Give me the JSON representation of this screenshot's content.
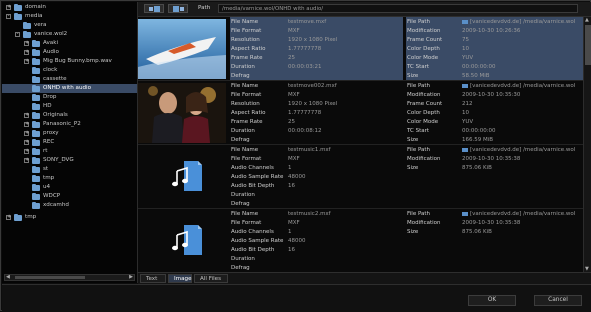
{
  "path_label": "Path",
  "path_value": "/media/varnice.wol/ONHD with audio/",
  "tree": [
    {
      "label": "domain",
      "level": 0,
      "expander": "+"
    },
    {
      "label": "media",
      "level": 0,
      "expander": "-"
    },
    {
      "label": "vera",
      "level": 1,
      "expander": ""
    },
    {
      "label": "vanice.wol2",
      "level": 1,
      "expander": "-"
    },
    {
      "label": "Avaki",
      "level": 2,
      "expander": "+"
    },
    {
      "label": "Audio",
      "level": 2,
      "expander": "+"
    },
    {
      "label": "Mig Bug Bunny.bmp.wav",
      "level": 2,
      "expander": "+"
    },
    {
      "label": "clock",
      "level": 2,
      "expander": ""
    },
    {
      "label": "cassette",
      "level": 2,
      "expander": ""
    },
    {
      "label": "ONHD with audio",
      "level": 2,
      "expander": "",
      "selected": true
    },
    {
      "label": "Drop",
      "level": 2,
      "expander": ""
    },
    {
      "label": "HD",
      "level": 2,
      "expander": ""
    },
    {
      "label": "Originals",
      "level": 2,
      "expander": "+"
    },
    {
      "label": "Panasonic_P2",
      "level": 2,
      "expander": "+"
    },
    {
      "label": "proxy",
      "level": 2,
      "expander": "+"
    },
    {
      "label": "REC",
      "level": 2,
      "expander": "+"
    },
    {
      "label": "rt",
      "level": 2,
      "expander": "+"
    },
    {
      "label": "SONY_DVG",
      "level": 2,
      "expander": "+"
    },
    {
      "label": "st",
      "level": 2,
      "expander": ""
    },
    {
      "label": "tmp",
      "level": 2,
      "expander": ""
    },
    {
      "label": "u4",
      "level": 2,
      "expander": ""
    },
    {
      "label": "WDCP",
      "level": 2,
      "expander": ""
    },
    {
      "label": "xdcamhd",
      "level": 2,
      "expander": ""
    },
    {
      "label": "tmp",
      "level": 0,
      "expander": "+",
      "gap": true
    }
  ],
  "entries": [
    {
      "thumb": "boat",
      "selected": true,
      "left": [
        {
          "k": "File Name",
          "v": "testmove.mxf"
        },
        {
          "k": "File Format",
          "v": "MXF"
        },
        {
          "k": "Resolution",
          "v": "1920 x 1080 Pixel"
        },
        {
          "k": "Aspect Ratio",
          "v": "1.77777778"
        },
        {
          "k": "Frame Rate",
          "v": "25"
        },
        {
          "k": "Duration",
          "v": "00:00:03:21"
        },
        {
          "k": "Defrag",
          "v": ""
        }
      ],
      "right": [
        {
          "k": "File Path",
          "v": "[vanicedevdvd.de] /media/varnice.wol",
          "link": true
        },
        {
          "k": "Modification",
          "v": "2009-10-30 10:26:36"
        },
        {
          "k": "Frame Count",
          "v": "75"
        },
        {
          "k": "Color Depth",
          "v": "10"
        },
        {
          "k": "Color Mode",
          "v": "YUV"
        },
        {
          "k": "TC Start",
          "v": "00:00:00:00"
        },
        {
          "k": "Size",
          "v": "58.50 MiB"
        }
      ]
    },
    {
      "thumb": "couple",
      "selected": false,
      "left": [
        {
          "k": "File Name",
          "v": "testmove002.mxf"
        },
        {
          "k": "File Format",
          "v": "MXF"
        },
        {
          "k": "Resolution",
          "v": "1920 x 1080 Pixel"
        },
        {
          "k": "Aspect Ratio",
          "v": "1.77777778"
        },
        {
          "k": "Frame Rate",
          "v": "25"
        },
        {
          "k": "Duration",
          "v": "00:00:08:12"
        },
        {
          "k": "Defrag",
          "v": ""
        }
      ],
      "right": [
        {
          "k": "File Path",
          "v": "[vanicedevdvd.de] /media/varnice.wol",
          "link": true
        },
        {
          "k": "Modification",
          "v": "2009-10-30 10:35:30"
        },
        {
          "k": "Frame Count",
          "v": "212"
        },
        {
          "k": "Color Depth",
          "v": "10"
        },
        {
          "k": "Color Mode",
          "v": "YUV"
        },
        {
          "k": "TC Start",
          "v": "00:00:00:00"
        },
        {
          "k": "Size",
          "v": "166.59 MiB"
        }
      ]
    },
    {
      "thumb": "audio",
      "selected": false,
      "left": [
        {
          "k": "File Name",
          "v": "testmusic1.mxf"
        },
        {
          "k": "File Format",
          "v": "MXF"
        },
        {
          "k": "Audio Channels",
          "v": "1"
        },
        {
          "k": "Audio Sample Rate",
          "v": "48000"
        },
        {
          "k": "Audio Bit Depth",
          "v": "16"
        },
        {
          "k": "Duration",
          "v": ""
        },
        {
          "k": "Defrag",
          "v": ""
        }
      ],
      "right": [
        {
          "k": "File Path",
          "v": "[vanicedevdvd.de] /media/varnice.wol",
          "link": true
        },
        {
          "k": "Modification",
          "v": "2009-10-30 10:35:38"
        },
        {
          "k": "Size",
          "v": "875.06 KiB"
        }
      ]
    },
    {
      "thumb": "audio",
      "selected": false,
      "left": [
        {
          "k": "File Name",
          "v": "testmusic2.mxf"
        },
        {
          "k": "File Format",
          "v": "MXF"
        },
        {
          "k": "Audio Channels",
          "v": "1"
        },
        {
          "k": "Audio Sample Rate",
          "v": "48000"
        },
        {
          "k": "Audio Bit Depth",
          "v": "16"
        },
        {
          "k": "Duration",
          "v": ""
        },
        {
          "k": "Defrag",
          "v": ""
        }
      ],
      "right": [
        {
          "k": "File Path",
          "v": "[vanicedevdvd.de] /media/varnice.wol",
          "link": true
        },
        {
          "k": "Modification",
          "v": "2009-10-30 10:35:38"
        },
        {
          "k": "Size",
          "v": "875.06 KiB"
        }
      ]
    }
  ],
  "tabs": [
    {
      "label": "Text",
      "active": false
    },
    {
      "label": "Image",
      "active": true
    },
    {
      "label": "All Files",
      "active": false
    }
  ],
  "buttons": {
    "ok": "OK",
    "cancel": "Cancel"
  },
  "icons": {
    "back": "back-icon",
    "forward": "forward-icon",
    "audio": "audio-note-icon",
    "folder": "folder-icon"
  },
  "colors": {
    "selection": "#3a4b66",
    "folder": "#6e9fd0",
    "audio_doc": "#4a90d9"
  }
}
